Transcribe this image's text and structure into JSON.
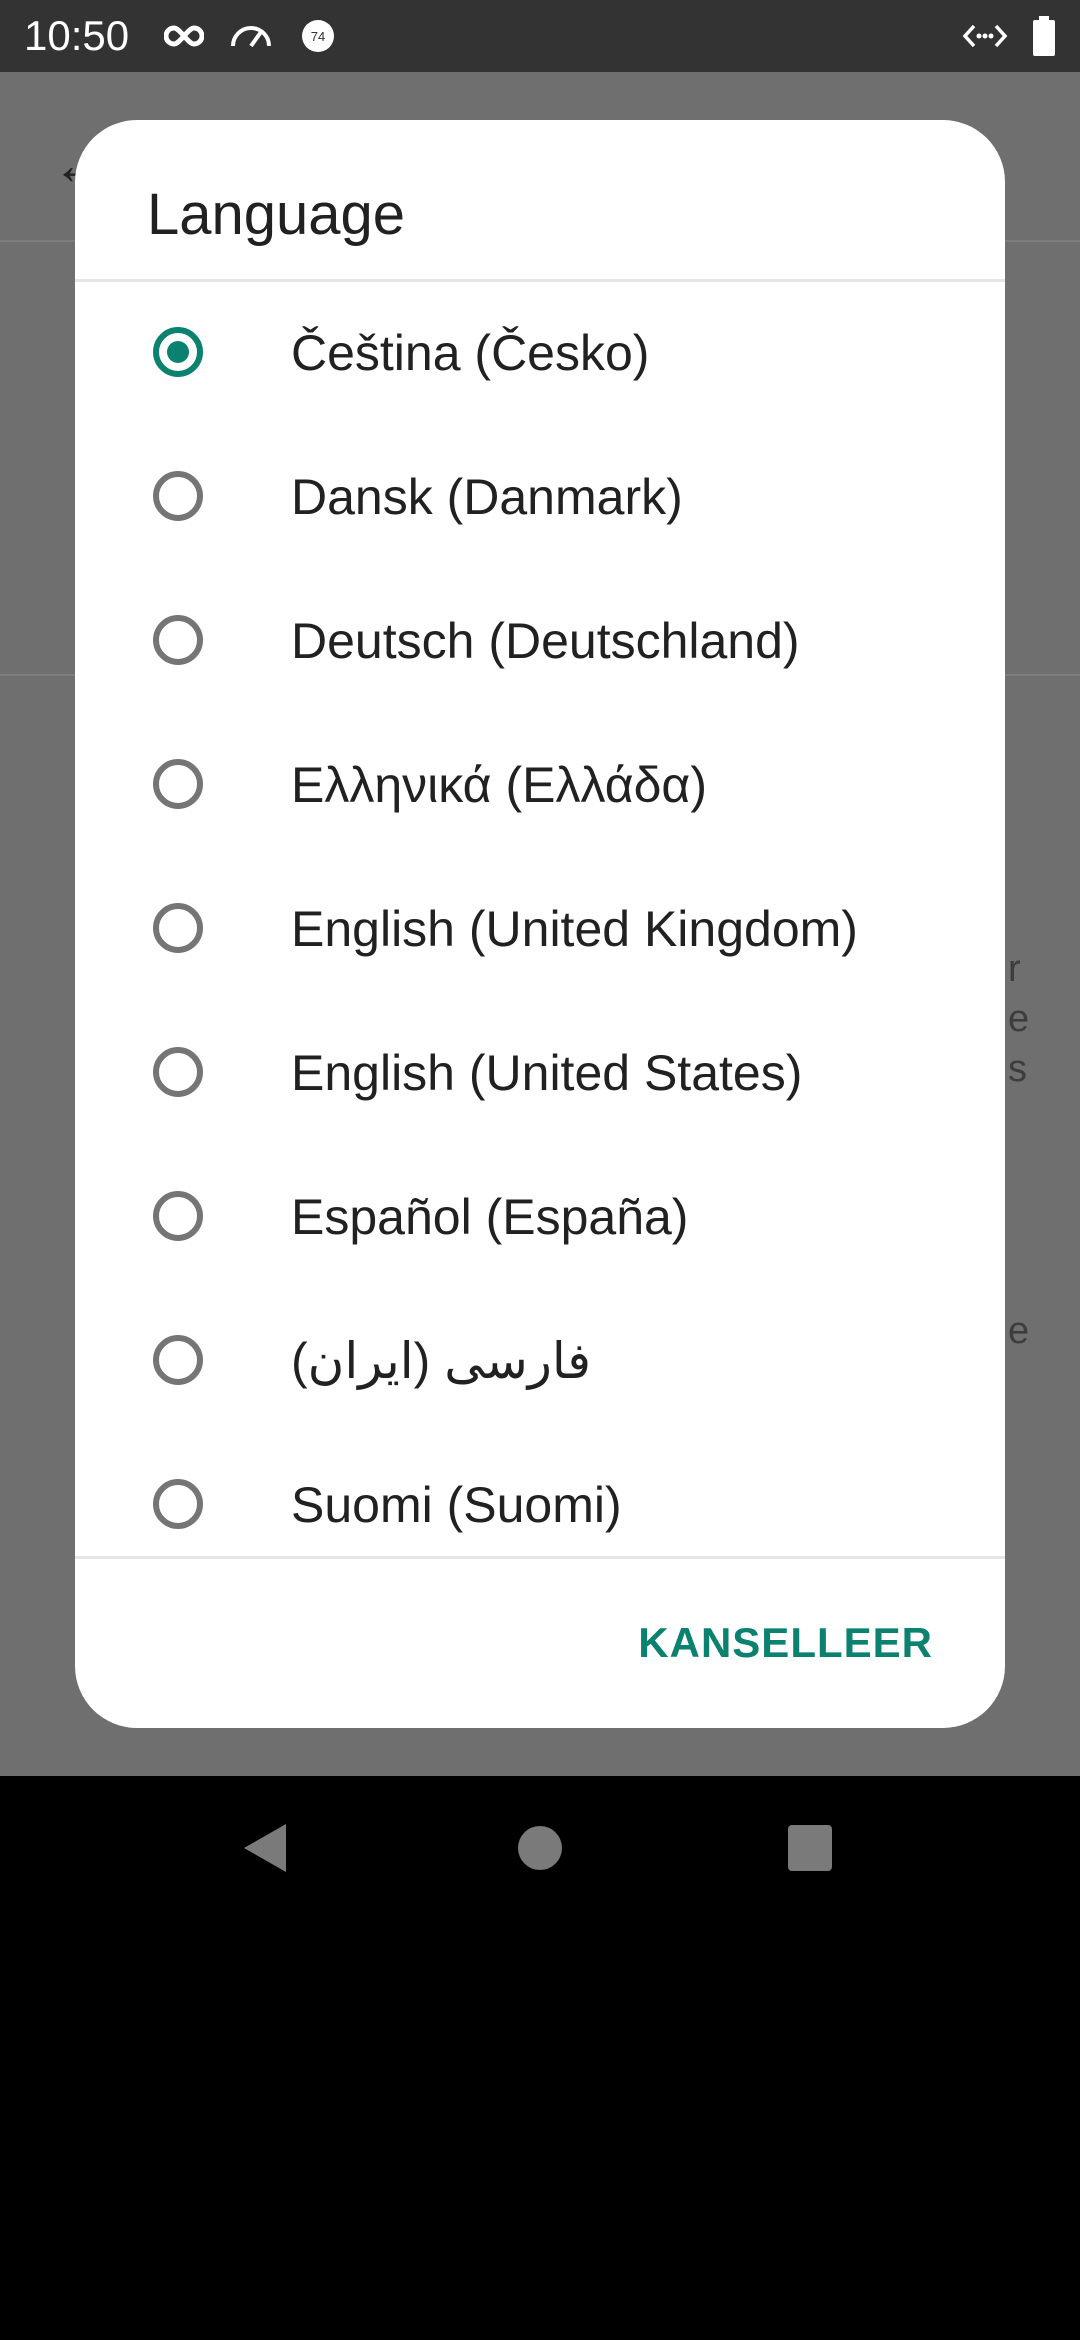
{
  "status_bar": {
    "time": "10:50",
    "icons": [
      "infinity-icon",
      "speedometer-icon",
      "badge-74-icon",
      "code-arrows-icon",
      "battery-icon"
    ],
    "badge_text": "74"
  },
  "background": {
    "fragments": [
      "r",
      "e",
      "s",
      "e"
    ]
  },
  "dialog": {
    "title": "Language",
    "selected_index": 0,
    "options": [
      {
        "label": "Čeština (Česko)",
        "selected": true
      },
      {
        "label": "Dansk (Danmark)",
        "selected": false
      },
      {
        "label": "Deutsch (Deutschland)",
        "selected": false
      },
      {
        "label": "Ελληνικά (Ελλάδα)",
        "selected": false
      },
      {
        "label": "English (United Kingdom)",
        "selected": false
      },
      {
        "label": "English (United States)",
        "selected": false
      },
      {
        "label": "Español (España)",
        "selected": false
      },
      {
        "label": "فارسی (ایران)",
        "selected": false
      },
      {
        "label": "Suomi (Suomi)",
        "selected": false
      }
    ],
    "cancel_label": "KANSELLEER"
  },
  "colors": {
    "accent": "#0b8270",
    "scrim": "#6f6f6f",
    "status_bar": "#333333"
  }
}
